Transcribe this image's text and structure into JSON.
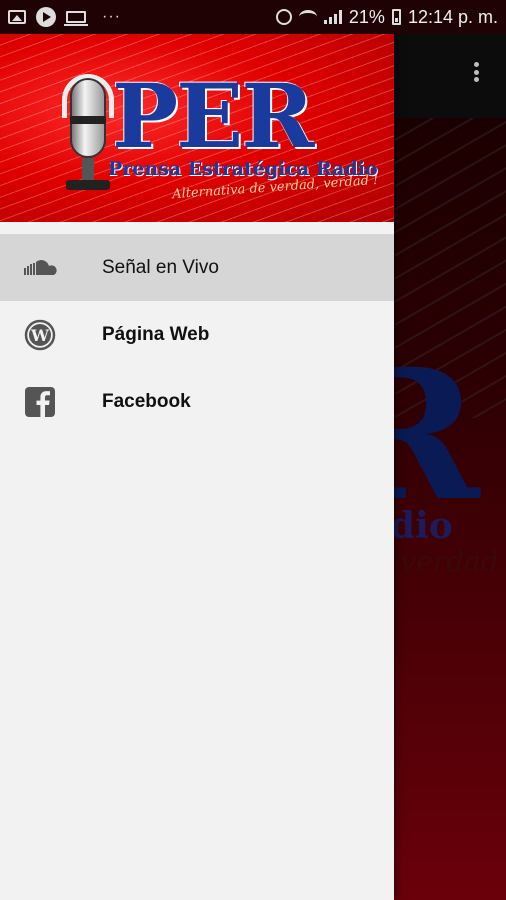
{
  "status_bar": {
    "battery": "21%",
    "time": "12:14 p. m.",
    "more": "···"
  },
  "header": {
    "logo_text": "PER",
    "subtitle": "Prensa Estratégica Radio",
    "tagline": "Alternativa de verdad, verdad !"
  },
  "menu": {
    "items": [
      {
        "label": "Señal en Vivo",
        "icon": "soundcloud-icon",
        "active": true
      },
      {
        "label": "Página Web",
        "icon": "wordpress-icon",
        "active": false
      },
      {
        "label": "Facebook",
        "icon": "facebook-icon",
        "active": false
      }
    ]
  },
  "background": {
    "logo_partial": "R",
    "subtitle_partial": "a Radio",
    "tagline_partial": "dad, verdad"
  },
  "colors": {
    "header_red": "#e00000",
    "logo_blue": "#1a3a9e",
    "drawer_bg": "#f2f2f2",
    "active_item": "#d6d6d6"
  }
}
